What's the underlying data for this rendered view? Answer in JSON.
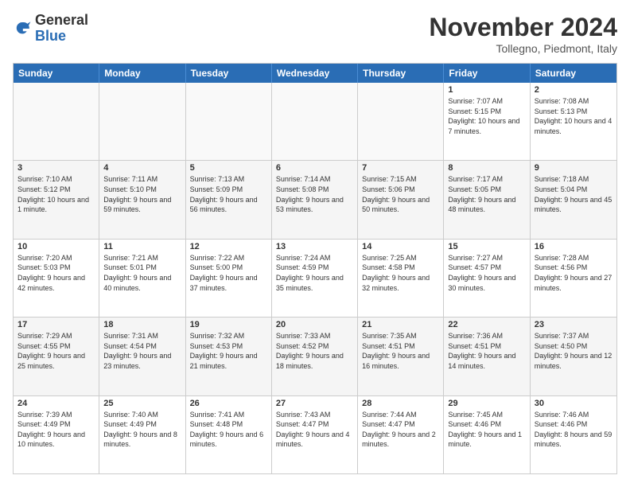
{
  "logo": {
    "general": "General",
    "blue": "Blue"
  },
  "header": {
    "month": "November 2024",
    "location": "Tollegno, Piedmont, Italy"
  },
  "weekdays": [
    "Sunday",
    "Monday",
    "Tuesday",
    "Wednesday",
    "Thursday",
    "Friday",
    "Saturday"
  ],
  "rows": [
    [
      {
        "day": "",
        "info": ""
      },
      {
        "day": "",
        "info": ""
      },
      {
        "day": "",
        "info": ""
      },
      {
        "day": "",
        "info": ""
      },
      {
        "day": "",
        "info": ""
      },
      {
        "day": "1",
        "info": "Sunrise: 7:07 AM\nSunset: 5:15 PM\nDaylight: 10 hours and 7 minutes."
      },
      {
        "day": "2",
        "info": "Sunrise: 7:08 AM\nSunset: 5:13 PM\nDaylight: 10 hours and 4 minutes."
      }
    ],
    [
      {
        "day": "3",
        "info": "Sunrise: 7:10 AM\nSunset: 5:12 PM\nDaylight: 10 hours and 1 minute."
      },
      {
        "day": "4",
        "info": "Sunrise: 7:11 AM\nSunset: 5:10 PM\nDaylight: 9 hours and 59 minutes."
      },
      {
        "day": "5",
        "info": "Sunrise: 7:13 AM\nSunset: 5:09 PM\nDaylight: 9 hours and 56 minutes."
      },
      {
        "day": "6",
        "info": "Sunrise: 7:14 AM\nSunset: 5:08 PM\nDaylight: 9 hours and 53 minutes."
      },
      {
        "day": "7",
        "info": "Sunrise: 7:15 AM\nSunset: 5:06 PM\nDaylight: 9 hours and 50 minutes."
      },
      {
        "day": "8",
        "info": "Sunrise: 7:17 AM\nSunset: 5:05 PM\nDaylight: 9 hours and 48 minutes."
      },
      {
        "day": "9",
        "info": "Sunrise: 7:18 AM\nSunset: 5:04 PM\nDaylight: 9 hours and 45 minutes."
      }
    ],
    [
      {
        "day": "10",
        "info": "Sunrise: 7:20 AM\nSunset: 5:03 PM\nDaylight: 9 hours and 42 minutes."
      },
      {
        "day": "11",
        "info": "Sunrise: 7:21 AM\nSunset: 5:01 PM\nDaylight: 9 hours and 40 minutes."
      },
      {
        "day": "12",
        "info": "Sunrise: 7:22 AM\nSunset: 5:00 PM\nDaylight: 9 hours and 37 minutes."
      },
      {
        "day": "13",
        "info": "Sunrise: 7:24 AM\nSunset: 4:59 PM\nDaylight: 9 hours and 35 minutes."
      },
      {
        "day": "14",
        "info": "Sunrise: 7:25 AM\nSunset: 4:58 PM\nDaylight: 9 hours and 32 minutes."
      },
      {
        "day": "15",
        "info": "Sunrise: 7:27 AM\nSunset: 4:57 PM\nDaylight: 9 hours and 30 minutes."
      },
      {
        "day": "16",
        "info": "Sunrise: 7:28 AM\nSunset: 4:56 PM\nDaylight: 9 hours and 27 minutes."
      }
    ],
    [
      {
        "day": "17",
        "info": "Sunrise: 7:29 AM\nSunset: 4:55 PM\nDaylight: 9 hours and 25 minutes."
      },
      {
        "day": "18",
        "info": "Sunrise: 7:31 AM\nSunset: 4:54 PM\nDaylight: 9 hours and 23 minutes."
      },
      {
        "day": "19",
        "info": "Sunrise: 7:32 AM\nSunset: 4:53 PM\nDaylight: 9 hours and 21 minutes."
      },
      {
        "day": "20",
        "info": "Sunrise: 7:33 AM\nSunset: 4:52 PM\nDaylight: 9 hours and 18 minutes."
      },
      {
        "day": "21",
        "info": "Sunrise: 7:35 AM\nSunset: 4:51 PM\nDaylight: 9 hours and 16 minutes."
      },
      {
        "day": "22",
        "info": "Sunrise: 7:36 AM\nSunset: 4:51 PM\nDaylight: 9 hours and 14 minutes."
      },
      {
        "day": "23",
        "info": "Sunrise: 7:37 AM\nSunset: 4:50 PM\nDaylight: 9 hours and 12 minutes."
      }
    ],
    [
      {
        "day": "24",
        "info": "Sunrise: 7:39 AM\nSunset: 4:49 PM\nDaylight: 9 hours and 10 minutes."
      },
      {
        "day": "25",
        "info": "Sunrise: 7:40 AM\nSunset: 4:49 PM\nDaylight: 9 hours and 8 minutes."
      },
      {
        "day": "26",
        "info": "Sunrise: 7:41 AM\nSunset: 4:48 PM\nDaylight: 9 hours and 6 minutes."
      },
      {
        "day": "27",
        "info": "Sunrise: 7:43 AM\nSunset: 4:47 PM\nDaylight: 9 hours and 4 minutes."
      },
      {
        "day": "28",
        "info": "Sunrise: 7:44 AM\nSunset: 4:47 PM\nDaylight: 9 hours and 2 minutes."
      },
      {
        "day": "29",
        "info": "Sunrise: 7:45 AM\nSunset: 4:46 PM\nDaylight: 9 hours and 1 minute."
      },
      {
        "day": "30",
        "info": "Sunrise: 7:46 AM\nSunset: 4:46 PM\nDaylight: 8 hours and 59 minutes."
      }
    ]
  ]
}
